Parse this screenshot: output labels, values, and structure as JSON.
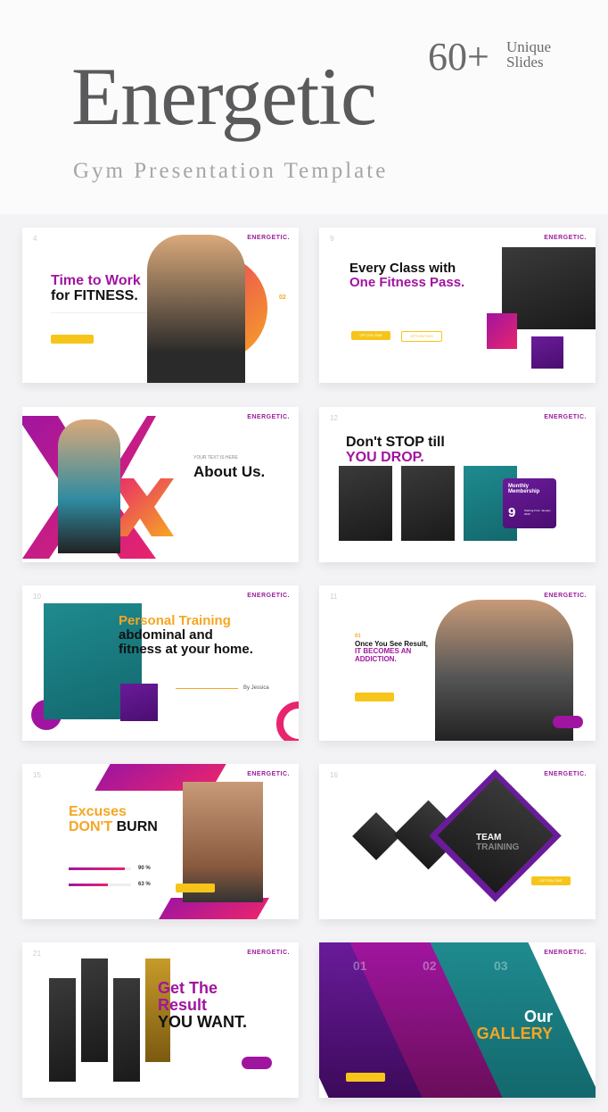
{
  "header": {
    "title": "Energetic",
    "subtitle": "Gym Presentation Template",
    "count": "60+",
    "count_label_1": "Unique",
    "count_label_2": "Slides"
  },
  "brand": "ENERGETIC.",
  "slides": [
    {
      "num": "4",
      "line1": "Time to Work",
      "line2": "for FITNESS.",
      "step": "02"
    },
    {
      "num": "9",
      "line1": "Every Class with",
      "line2": "One Fitness Pass.",
      "option1": "OPTION ONE",
      "option2": "OPTION TWO"
    },
    {
      "line_small": "YOUR TEXT IS HERE",
      "title": "About Us."
    },
    {
      "num": "12",
      "line1": "Don't STOP till",
      "line2": "YOU DROP.",
      "card_title": "Monthly Membership",
      "card_value": "9",
      "card_sub": "Starting From January 2020"
    },
    {
      "num": "10",
      "line1": "Personal Training",
      "line2": "abdominal and",
      "line3": "fitness at your home.",
      "byline": "By Jessica"
    },
    {
      "num": "11",
      "step": "01",
      "line1": "Once You See Result,",
      "line2": "IT BECOMES AN",
      "line3": "ADDICTION."
    },
    {
      "num": "15",
      "line1": "Excuses",
      "line2a": "DON'T",
      "line2b": " BURN",
      "stat1": "90 %",
      "stat2": "63 %",
      "stat1_value": 90,
      "stat2_value": 63
    },
    {
      "num": "16",
      "line1": "TEAM",
      "line2": "TRAINING",
      "option": "OPTION ONE"
    },
    {
      "num": "21",
      "line1": "Get The",
      "line2": "Result",
      "line3": "YOU WANT."
    },
    {
      "n1": "01",
      "n2": "02",
      "n3": "03",
      "line1": "Our",
      "line2": "GALLERY"
    }
  ],
  "colors": {
    "purple": "#a0159f",
    "orange": "#f5a623",
    "yellow": "#f7c51a",
    "teal": "#1f8b8f"
  }
}
